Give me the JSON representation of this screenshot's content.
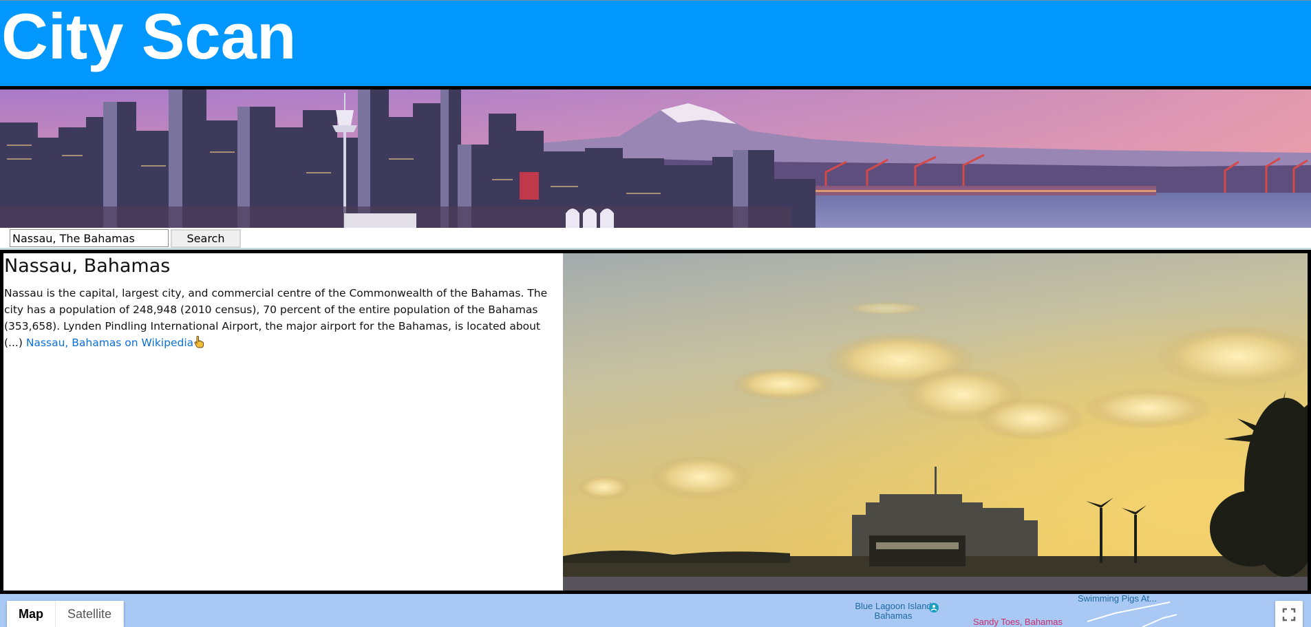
{
  "header": {
    "title": "City Scan"
  },
  "search": {
    "value": "Nassau, The Bahamas",
    "button_label": "Search"
  },
  "city": {
    "name": "Nassau, Bahamas",
    "description": "Nassau is the capital, largest city, and commercial centre of the Commonwealth of the Bahamas. The city has a population of 248,948 (2010 census), 70 percent of the entire population of the Bahamas (353,658). Lynden Pindling International Airport, the major airport for the Bahamas, is located about (...)",
    "wiki_link_label": "Nassau, Bahamas on Wikipedia"
  },
  "map": {
    "tabs": [
      {
        "label": "Map",
        "active": true
      },
      {
        "label": "Satellite",
        "active": false
      }
    ],
    "labels": {
      "blue_lagoon": "Blue Lagoon Island Bahamas",
      "swimming_pigs": "Swimming Pigs At...",
      "sandy_toes": "Sandy Toes, Bahamas"
    }
  },
  "colors": {
    "header_bg": "#0197fd",
    "link": "#0a6fd8",
    "map_water": "#a9c8f4"
  },
  "icons": {
    "pointer": "hand-pointer-icon",
    "fullscreen": "fullscreen-icon",
    "map_pin": "map-pin-icon"
  }
}
